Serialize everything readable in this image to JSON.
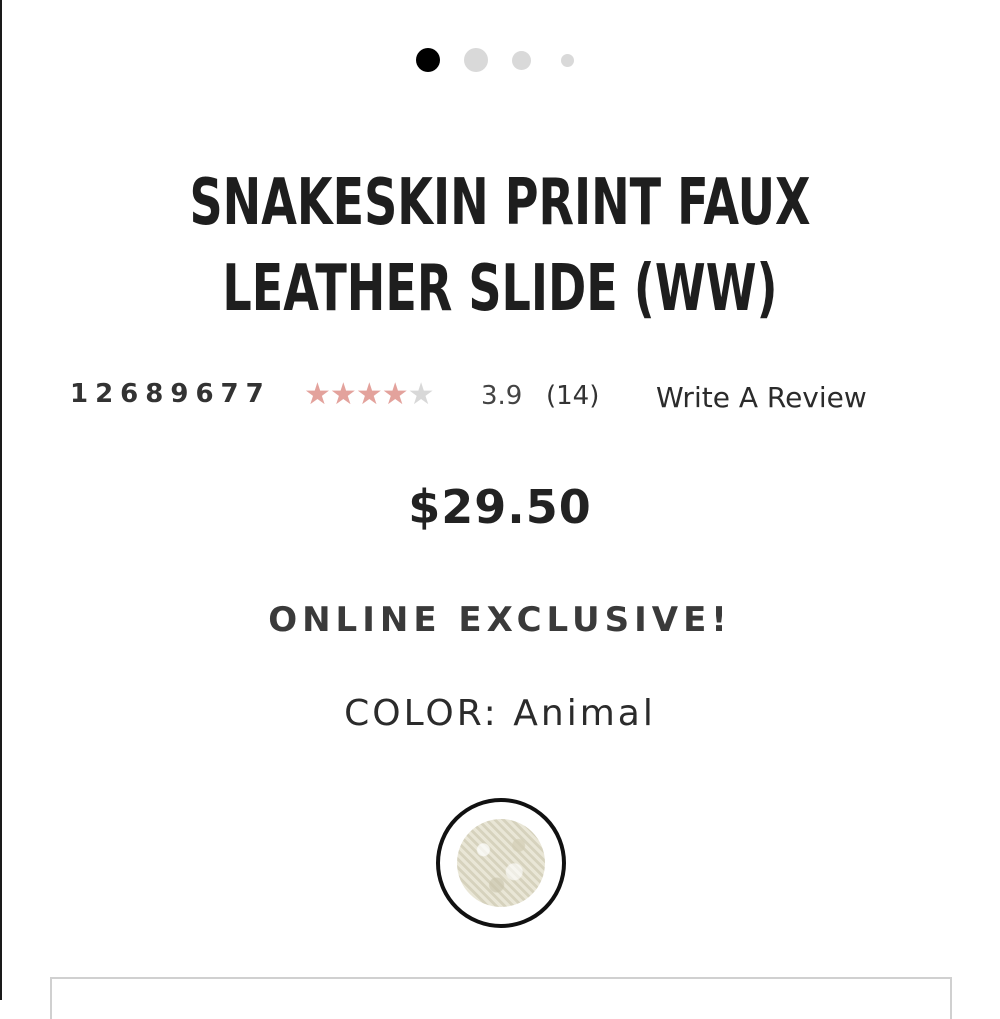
{
  "carousel": {
    "total_dots": 4,
    "active_index": 0
  },
  "product": {
    "title_line1": "SNAKESKIN PRINT FAUX",
    "title_line2": "LEATHER SLIDE (WW)",
    "sku": "12689677",
    "rating": {
      "value": "3.9",
      "out_of": 5,
      "count_text": "(14)",
      "star_color": "#e3a29c"
    },
    "write_review_label": "Write A Review",
    "price": "$29.50",
    "badge": "ONLINE EXCLUSIVE!",
    "color_label": "COLOR:",
    "color_value": "Animal"
  },
  "swatch": {
    "name": "Animal",
    "selected": true
  }
}
